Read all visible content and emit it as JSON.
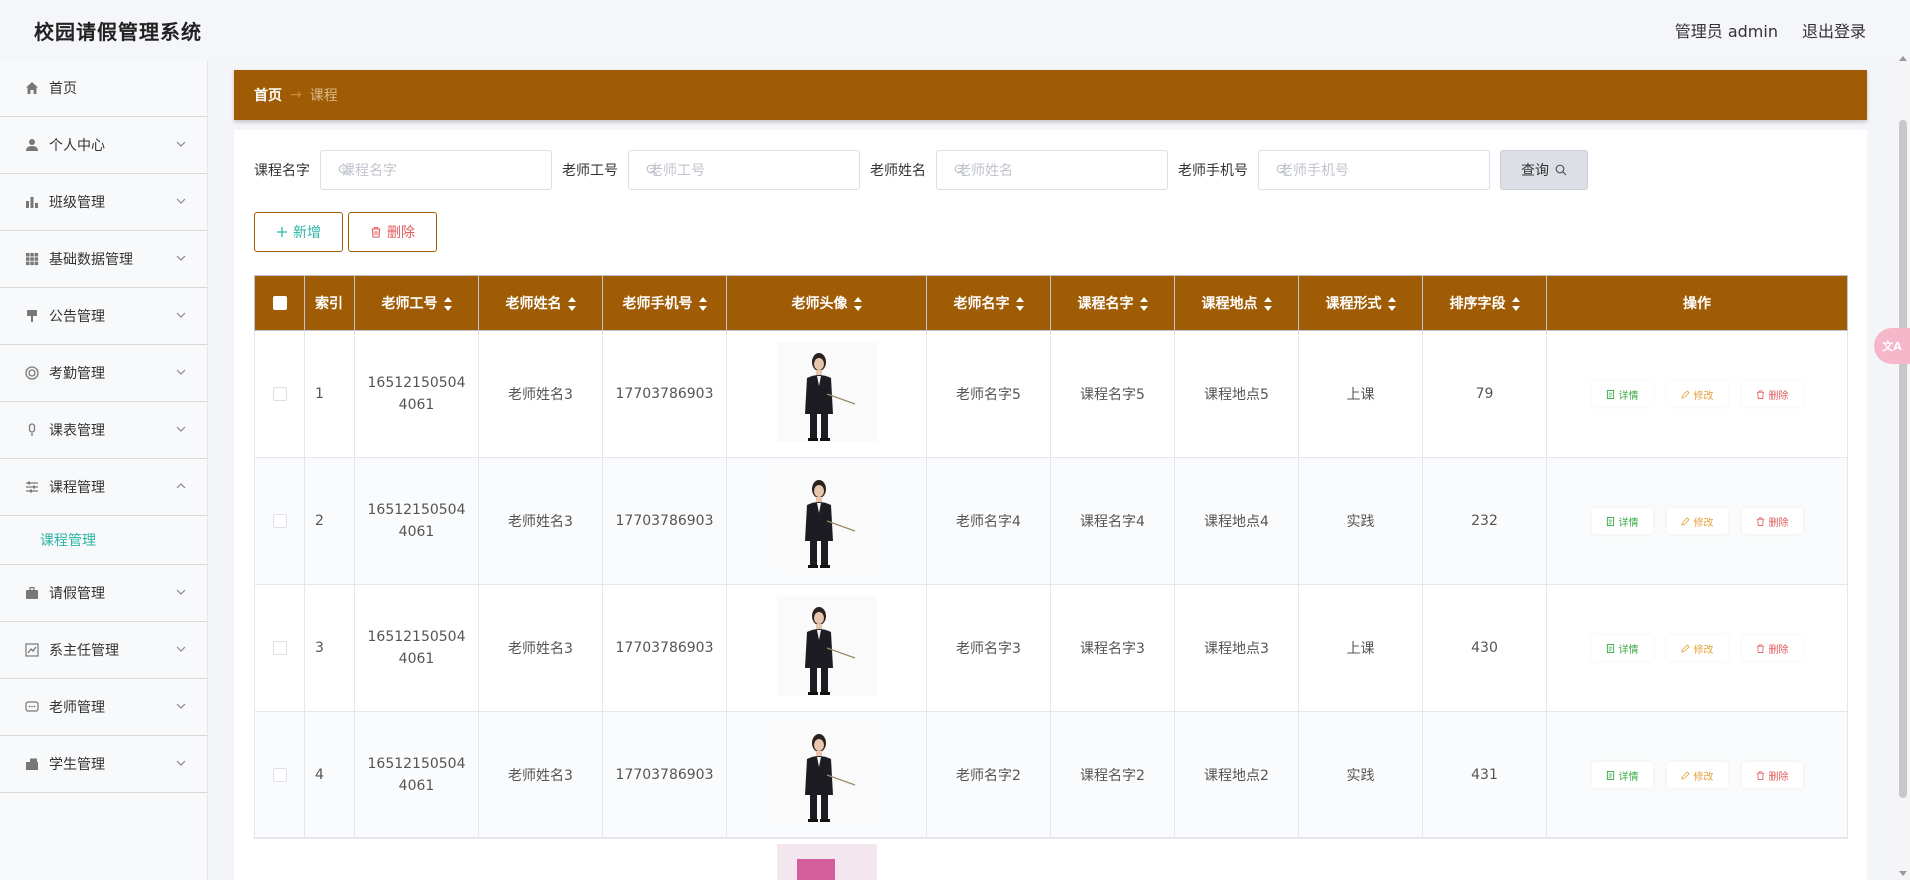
{
  "header": {
    "app_title": "校园请假管理系统",
    "user_label": "管理员 admin",
    "logout_label": "退出登录"
  },
  "sidebar": {
    "items": [
      {
        "label": "首页",
        "icon": "home-icon",
        "expandable": false
      },
      {
        "label": "个人中心",
        "icon": "user-icon",
        "expandable": true
      },
      {
        "label": "班级管理",
        "icon": "bar-chart-icon",
        "expandable": true
      },
      {
        "label": "基础数据管理",
        "icon": "grid-icon",
        "expandable": true
      },
      {
        "label": "公告管理",
        "icon": "brush-icon",
        "expandable": true
      },
      {
        "label": "考勤管理",
        "icon": "target-icon",
        "expandable": true
      },
      {
        "label": "课表管理",
        "icon": "microphone-icon",
        "expandable": true
      },
      {
        "label": "课程管理",
        "icon": "sliders-icon",
        "expandable": true,
        "expanded": true
      },
      {
        "label": "请假管理",
        "icon": "briefcase-icon",
        "expandable": true
      },
      {
        "label": "系主任管理",
        "icon": "line-chart-icon",
        "expandable": true
      },
      {
        "label": "老师管理",
        "icon": "chat-icon",
        "expandable": true
      },
      {
        "label": "学生管理",
        "icon": "pickup-icon",
        "expandable": true
      }
    ],
    "sub_item": "课程管理"
  },
  "breadcrumb": {
    "home": "首页",
    "separator": "→",
    "current": "课程"
  },
  "search": {
    "fields": [
      {
        "label": "课程名字",
        "placeholder": "课程名字"
      },
      {
        "label": "老师工号",
        "placeholder": "老师工号"
      },
      {
        "label": "老师姓名",
        "placeholder": "老师姓名"
      },
      {
        "label": "老师手机号",
        "placeholder": "老师手机号"
      }
    ],
    "query_label": "查询"
  },
  "actions": {
    "add_label": "新增",
    "delete_label": "删除"
  },
  "table": {
    "columns": [
      "索引",
      "老师工号",
      "老师姓名",
      "老师手机号",
      "老师头像",
      "老师名字",
      "课程名字",
      "课程地点",
      "课程形式",
      "排序字段",
      "操作"
    ],
    "rows": [
      {
        "index": "1",
        "teacher_id": "165121505044061",
        "teacher_name": "老师姓名3",
        "phone": "17703786903",
        "name": "老师名字5",
        "course": "课程名字5",
        "location": "课程地点5",
        "form": "上课",
        "sort": "79"
      },
      {
        "index": "2",
        "teacher_id": "165121505044061",
        "teacher_name": "老师姓名3",
        "phone": "17703786903",
        "name": "老师名字4",
        "course": "课程名字4",
        "location": "课程地点4",
        "form": "实践",
        "sort": "232"
      },
      {
        "index": "3",
        "teacher_id": "165121505044061",
        "teacher_name": "老师姓名3",
        "phone": "17703786903",
        "name": "老师名字3",
        "course": "课程名字3",
        "location": "课程地点3",
        "form": "上课",
        "sort": "430"
      },
      {
        "index": "4",
        "teacher_id": "165121505044061",
        "teacher_name": "老师姓名3",
        "phone": "17703786903",
        "name": "老师名字2",
        "course": "课程名字2",
        "location": "课程地点2",
        "form": "实践",
        "sort": "431"
      }
    ],
    "ops": {
      "detail": "详情",
      "edit": "修改",
      "remove": "删除"
    }
  },
  "colors": {
    "accent": "#a05c04",
    "teal": "#2bb5a3",
    "danger": "#e05a5a",
    "success": "#39a844",
    "warning": "#e6a23c"
  }
}
